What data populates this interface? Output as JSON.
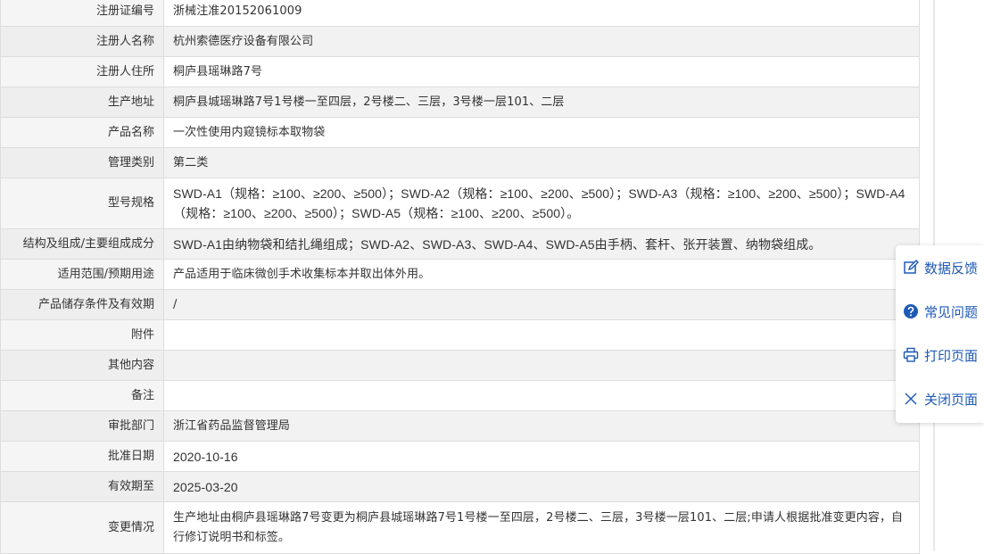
{
  "rows": [
    {
      "label": "注册证编号",
      "value": "浙械注准20152061009"
    },
    {
      "label": "注册人名称",
      "value": "杭州索德医疗设备有限公司"
    },
    {
      "label": "注册人住所",
      "value": "桐庐县瑶琳路7号"
    },
    {
      "label": "生产地址",
      "value": "桐庐县城瑶琳路7号1号楼一至四层，2号楼二、三层，3号楼一层101、二层"
    },
    {
      "label": "产品名称",
      "value": "一次性使用内窥镜标本取物袋"
    },
    {
      "label": "管理类别",
      "value": "第二类"
    },
    {
      "label": "型号规格",
      "value": "SWD-A1（规格：≥100、≥200、≥500）；SWD-A2（规格：≥100、≥200、≥500）；SWD-A3（规格：≥100、≥200、≥500）；SWD-A4（规格：≥100、≥200、≥500）；SWD-A5（规格：≥100、≥200、≥500）。"
    },
    {
      "label": "结构及组成/主要组成成分",
      "value": "SWD-A1由纳物袋和结扎绳组成；SWD-A2、SWD-A3、SWD-A4、SWD-A5由手柄、套杆、张开装置、纳物袋组成。"
    },
    {
      "label": "适用范围/预期用途",
      "value": "产品适用于临床微创手术收集标本并取出体外用。"
    },
    {
      "label": "产品储存条件及有效期",
      "value": "/"
    },
    {
      "label": "附件",
      "value": ""
    },
    {
      "label": "其他内容",
      "value": ""
    },
    {
      "label": "备注",
      "value": ""
    },
    {
      "label": "审批部门",
      "value": "浙江省药品监督管理局"
    },
    {
      "label": "批准日期",
      "value": "2020-10-16"
    },
    {
      "label": "有效期至",
      "value": "2025-03-20"
    },
    {
      "label": "变更情况",
      "value": "生产地址由桐庐县瑶琳路7号变更为桐庐县城瑶琳路7号1号楼一至四层，2号楼二、三层，3号楼一层101、二层;申请人根据批准变更内容，自行修订说明书和标签。"
    }
  ],
  "toolbar": {
    "feedback": "数据反馈",
    "faq": "常见问题",
    "print": "打印页面",
    "close": "关闭页面"
  },
  "colors": {
    "link": "#1e5ab6",
    "border": "#dddddd",
    "label_bg": "#f5f5f5",
    "alt_bg": "#f2f2f2"
  },
  "icons": {
    "feedback": "edit-icon",
    "faq": "question-circle-icon",
    "print": "printer-icon",
    "close": "close-icon"
  }
}
